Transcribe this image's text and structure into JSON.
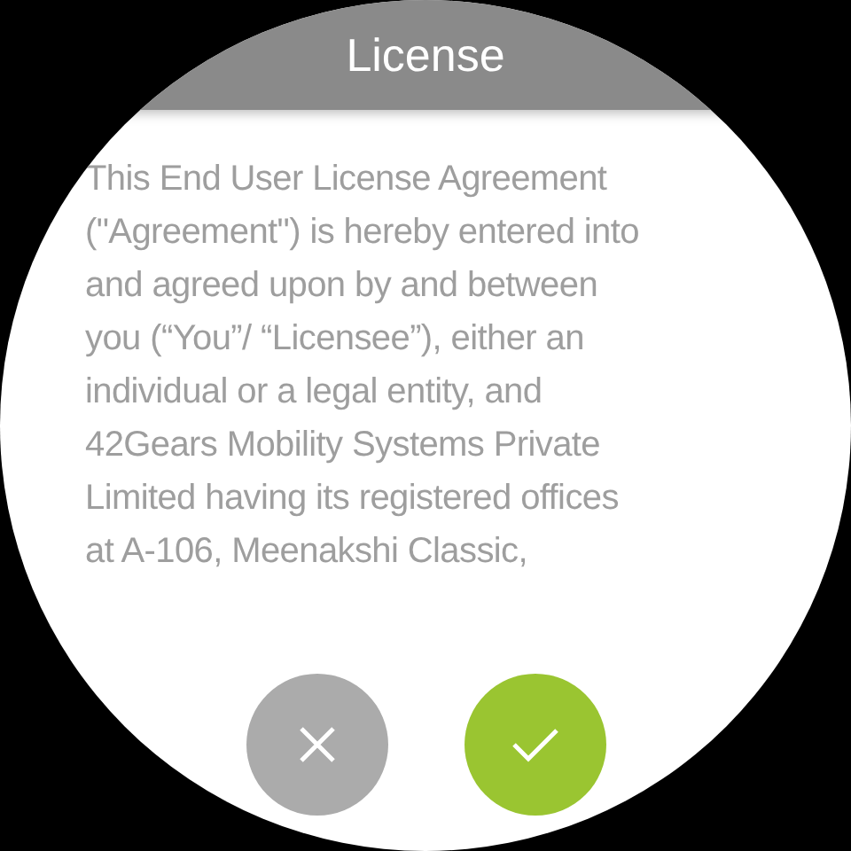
{
  "header": {
    "title": "License"
  },
  "agreement": {
    "lines": [
      "This End User License Agreement",
      "(\"Agreement\") is hereby entered into",
      "and agreed upon by and between",
      "you (“You”/ “Licensee”), either an",
      "individual or a legal entity, and",
      "42Gears Mobility Systems Private",
      "Limited having its registered offices",
      "at A-106, Meenakshi Classic,"
    ]
  },
  "buttons": [
    {
      "kind": "decline"
    },
    {
      "kind": "accept"
    }
  ]
}
